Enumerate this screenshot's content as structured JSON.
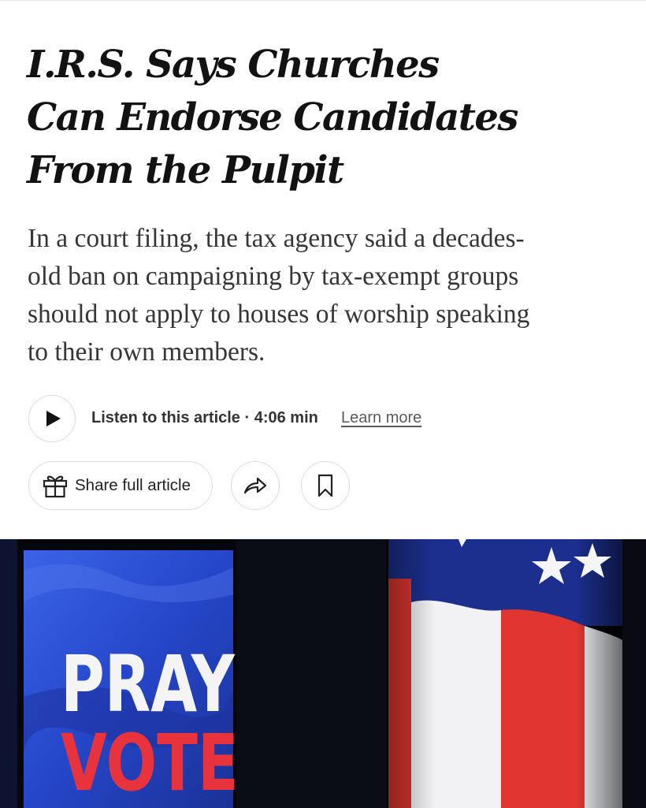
{
  "article": {
    "headline": [
      "I.R.S. Says Churches",
      "Can Endorse Candidates",
      "From the Pulpit"
    ],
    "summary": [
      "In a court filing, the tax agency said a decades-",
      "old ban on campaigning by tax-exempt groups",
      "should not apply to houses of worship speaking",
      "to their own members."
    ],
    "audio": {
      "listen_label": "Listen to this article · 4:06 min",
      "learn_more": "Learn more",
      "play_icon": "play-icon"
    },
    "actions": {
      "share_full_label": "Share full article",
      "gift_icon": "gift-icon",
      "share_icon": "share-arrow-icon",
      "bookmark_icon": "bookmark-icon"
    }
  },
  "photo": {
    "sign_lines": [
      "PRAY",
      "VOTE"
    ],
    "colors": {
      "sign_blue": "#2a4fd6",
      "text_white": "#f4f4f4",
      "text_red": "#e8323c",
      "flag_red": "#e0362f",
      "flag_blue": "#1c2f8e"
    }
  }
}
